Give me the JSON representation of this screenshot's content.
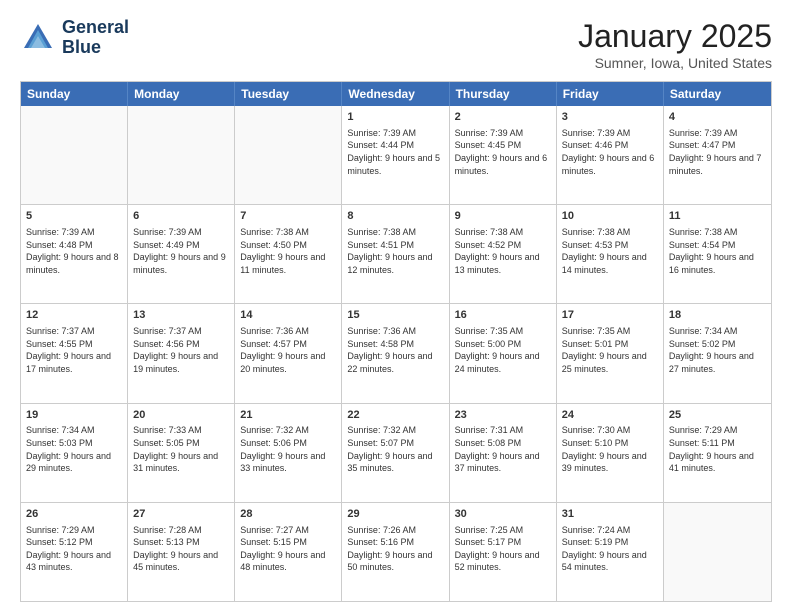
{
  "header": {
    "logo_line1": "General",
    "logo_line2": "Blue",
    "month": "January 2025",
    "location": "Sumner, Iowa, United States"
  },
  "weekdays": [
    "Sunday",
    "Monday",
    "Tuesday",
    "Wednesday",
    "Thursday",
    "Friday",
    "Saturday"
  ],
  "rows": [
    [
      {
        "day": "",
        "info": ""
      },
      {
        "day": "",
        "info": ""
      },
      {
        "day": "",
        "info": ""
      },
      {
        "day": "1",
        "info": "Sunrise: 7:39 AM\nSunset: 4:44 PM\nDaylight: 9 hours and 5 minutes."
      },
      {
        "day": "2",
        "info": "Sunrise: 7:39 AM\nSunset: 4:45 PM\nDaylight: 9 hours and 6 minutes."
      },
      {
        "day": "3",
        "info": "Sunrise: 7:39 AM\nSunset: 4:46 PM\nDaylight: 9 hours and 6 minutes."
      },
      {
        "day": "4",
        "info": "Sunrise: 7:39 AM\nSunset: 4:47 PM\nDaylight: 9 hours and 7 minutes."
      }
    ],
    [
      {
        "day": "5",
        "info": "Sunrise: 7:39 AM\nSunset: 4:48 PM\nDaylight: 9 hours and 8 minutes."
      },
      {
        "day": "6",
        "info": "Sunrise: 7:39 AM\nSunset: 4:49 PM\nDaylight: 9 hours and 9 minutes."
      },
      {
        "day": "7",
        "info": "Sunrise: 7:38 AM\nSunset: 4:50 PM\nDaylight: 9 hours and 11 minutes."
      },
      {
        "day": "8",
        "info": "Sunrise: 7:38 AM\nSunset: 4:51 PM\nDaylight: 9 hours and 12 minutes."
      },
      {
        "day": "9",
        "info": "Sunrise: 7:38 AM\nSunset: 4:52 PM\nDaylight: 9 hours and 13 minutes."
      },
      {
        "day": "10",
        "info": "Sunrise: 7:38 AM\nSunset: 4:53 PM\nDaylight: 9 hours and 14 minutes."
      },
      {
        "day": "11",
        "info": "Sunrise: 7:38 AM\nSunset: 4:54 PM\nDaylight: 9 hours and 16 minutes."
      }
    ],
    [
      {
        "day": "12",
        "info": "Sunrise: 7:37 AM\nSunset: 4:55 PM\nDaylight: 9 hours and 17 minutes."
      },
      {
        "day": "13",
        "info": "Sunrise: 7:37 AM\nSunset: 4:56 PM\nDaylight: 9 hours and 19 minutes."
      },
      {
        "day": "14",
        "info": "Sunrise: 7:36 AM\nSunset: 4:57 PM\nDaylight: 9 hours and 20 minutes."
      },
      {
        "day": "15",
        "info": "Sunrise: 7:36 AM\nSunset: 4:58 PM\nDaylight: 9 hours and 22 minutes."
      },
      {
        "day": "16",
        "info": "Sunrise: 7:35 AM\nSunset: 5:00 PM\nDaylight: 9 hours and 24 minutes."
      },
      {
        "day": "17",
        "info": "Sunrise: 7:35 AM\nSunset: 5:01 PM\nDaylight: 9 hours and 25 minutes."
      },
      {
        "day": "18",
        "info": "Sunrise: 7:34 AM\nSunset: 5:02 PM\nDaylight: 9 hours and 27 minutes."
      }
    ],
    [
      {
        "day": "19",
        "info": "Sunrise: 7:34 AM\nSunset: 5:03 PM\nDaylight: 9 hours and 29 minutes."
      },
      {
        "day": "20",
        "info": "Sunrise: 7:33 AM\nSunset: 5:05 PM\nDaylight: 9 hours and 31 minutes."
      },
      {
        "day": "21",
        "info": "Sunrise: 7:32 AM\nSunset: 5:06 PM\nDaylight: 9 hours and 33 minutes."
      },
      {
        "day": "22",
        "info": "Sunrise: 7:32 AM\nSunset: 5:07 PM\nDaylight: 9 hours and 35 minutes."
      },
      {
        "day": "23",
        "info": "Sunrise: 7:31 AM\nSunset: 5:08 PM\nDaylight: 9 hours and 37 minutes."
      },
      {
        "day": "24",
        "info": "Sunrise: 7:30 AM\nSunset: 5:10 PM\nDaylight: 9 hours and 39 minutes."
      },
      {
        "day": "25",
        "info": "Sunrise: 7:29 AM\nSunset: 5:11 PM\nDaylight: 9 hours and 41 minutes."
      }
    ],
    [
      {
        "day": "26",
        "info": "Sunrise: 7:29 AM\nSunset: 5:12 PM\nDaylight: 9 hours and 43 minutes."
      },
      {
        "day": "27",
        "info": "Sunrise: 7:28 AM\nSunset: 5:13 PM\nDaylight: 9 hours and 45 minutes."
      },
      {
        "day": "28",
        "info": "Sunrise: 7:27 AM\nSunset: 5:15 PM\nDaylight: 9 hours and 48 minutes."
      },
      {
        "day": "29",
        "info": "Sunrise: 7:26 AM\nSunset: 5:16 PM\nDaylight: 9 hours and 50 minutes."
      },
      {
        "day": "30",
        "info": "Sunrise: 7:25 AM\nSunset: 5:17 PM\nDaylight: 9 hours and 52 minutes."
      },
      {
        "day": "31",
        "info": "Sunrise: 7:24 AM\nSunset: 5:19 PM\nDaylight: 9 hours and 54 minutes."
      },
      {
        "day": "",
        "info": ""
      }
    ]
  ]
}
